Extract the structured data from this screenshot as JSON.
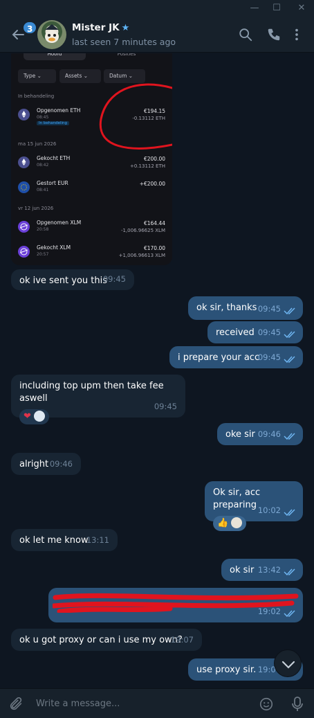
{
  "window": {
    "controls": [
      "—",
      "☐",
      "✕"
    ]
  },
  "header": {
    "unread_badge": "3",
    "title": "Mister JK",
    "status": "last seen 7 minutes ago",
    "icons": [
      "back-arrow-icon",
      "search-icon",
      "phone-icon",
      "more-vertical-icon"
    ]
  },
  "screenshot": {
    "tabs": [
      "Hoofd",
      "Posities"
    ],
    "filters": [
      "Type",
      "Assets",
      "Datum"
    ],
    "sections": [
      {
        "label": "In behandeling",
        "rows": [
          {
            "name": "Opgenomen ETH",
            "time": "08:45",
            "tag": "In behandeling",
            "amount": "€194.15",
            "sub": "-0.13112 ETH",
            "coin": "eth"
          }
        ]
      },
      {
        "label": "ma 15 jun 2026",
        "rows": [
          {
            "name": "Gekocht ETH",
            "time": "08:42",
            "amount": "€200.00",
            "sub": "+0.13112 ETH",
            "coin": "eth"
          },
          {
            "name": "Gestort EUR",
            "time": "08:41",
            "amount": "+€200.00",
            "sub": "",
            "coin": "eur"
          }
        ]
      },
      {
        "label": "vr 12 jun 2026",
        "rows": [
          {
            "name": "Opgenomen XLM",
            "time": "20:58",
            "amount": "€164.44",
            "sub": "-1,006.96625 XLM",
            "coin": "xlm"
          },
          {
            "name": "Gekocht XLM",
            "time": "20:57",
            "amount": "€170.00",
            "sub": "+1,006.96613 XLM",
            "coin": "xlm"
          }
        ]
      }
    ]
  },
  "messages": [
    {
      "dir": "in",
      "text": "ok ive sent you this",
      "time": "09:45"
    },
    {
      "dir": "out",
      "text": "ok sir, thanks",
      "time": "09:45"
    },
    {
      "dir": "out",
      "text": "received",
      "time": "09:45"
    },
    {
      "dir": "out",
      "text": "i prepare your acc",
      "time": "09:45"
    },
    {
      "dir": "in",
      "text": "including top upm then take fee aswell",
      "time": "09:45"
    },
    {
      "dir": "out",
      "text": "oke sir",
      "time": "09:46"
    },
    {
      "dir": "in",
      "text": "alright",
      "time": "09:46"
    },
    {
      "dir": "out",
      "text": "Ok sir, acc preparing",
      "time": "10:02"
    },
    {
      "dir": "in",
      "text": "ok let me know",
      "time": "13:11"
    },
    {
      "dir": "out",
      "text": "ok sir",
      "time": "13:42"
    },
    {
      "dir": "out",
      "text": "",
      "time": "19:02"
    },
    {
      "dir": "in",
      "text": "ok u got proxy or can i use my own?",
      "time": "19:07"
    },
    {
      "dir": "out",
      "text": "use proxy sir.",
      "time": "19:07"
    }
  ],
  "composer": {
    "placeholder": "Write a message..."
  },
  "colors": {
    "accent": "#5eb5f7",
    "outgoing": "#2b5278",
    "incoming": "#182533",
    "redact": "#e0141e"
  }
}
